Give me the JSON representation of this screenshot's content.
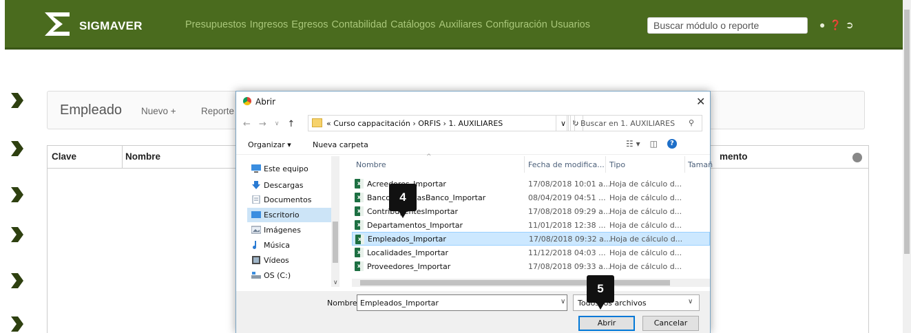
{
  "app": {
    "logo_text": "SIGMAVER",
    "nav": [
      "Presupuestos",
      "Ingresos",
      "Egresos",
      "Contabilidad",
      "Catálogos",
      "Auxiliares",
      "Configuración",
      "Usuarios"
    ],
    "search_placeholder": "Buscar módulo o reporte"
  },
  "panel": {
    "title": "Empleado",
    "new_label": "Nuevo +",
    "report_label": "Reporte"
  },
  "table": {
    "headers": [
      "Clave",
      "Nombre",
      "mento"
    ]
  },
  "dialog": {
    "title": "Abrir",
    "address": "« Curso cappacitación › ORFIS › 1. AUXILIARES",
    "search_placeholder": "Buscar en 1. AUXILIARES",
    "organize": "Organizar ▾",
    "new_folder": "Nueva carpeta",
    "nav_items": [
      "Este equipo",
      "Descargas",
      "Documentos",
      "Escritorio",
      "Imágenes",
      "Música",
      "Vídeos",
      "OS (C:)"
    ],
    "columns": [
      "Nombre",
      "Fecha de modifica...",
      "Tipo",
      "Tamañ"
    ],
    "files": [
      {
        "name": "Acreedores_Importar",
        "date": "17/08/2018 10:01 a...",
        "type": "Hoja de cálculo d..."
      },
      {
        "name": "BancosCuentasBanco_Importar",
        "date": "08/04/2019 04:51 ...",
        "type": "Hoja de cálculo d..."
      },
      {
        "name": "ContribuyentesImportar",
        "date": "17/08/2018 09:29 a...",
        "type": "Hoja de cálculo d..."
      },
      {
        "name": "Departamentos_Importar",
        "date": "11/01/2018 12:38 ...",
        "type": "Hoja de cálculo d..."
      },
      {
        "name": "Empleados_Importar",
        "date": "17/08/2018 09:32 a...",
        "type": "Hoja de cálculo d..."
      },
      {
        "name": "Localidades_Importar",
        "date": "11/12/2018 04:03 ...",
        "type": "Hoja de cálculo d..."
      },
      {
        "name": "Proveedores_Importar",
        "date": "17/08/2018 09:33 a...",
        "type": "Hoja de cálculo d..."
      }
    ],
    "filename_label": "Nombre:",
    "filename_value": "Empleados_Importar",
    "filetype_value": "Todos los archivos",
    "open_button": "Abrir",
    "cancel_button": "Cancelar"
  },
  "steps": [
    "4",
    "5"
  ],
  "colors": {
    "navbar": "#4a6b1e",
    "nav_link": "#a9c77a",
    "selection": "#cce8ff"
  }
}
